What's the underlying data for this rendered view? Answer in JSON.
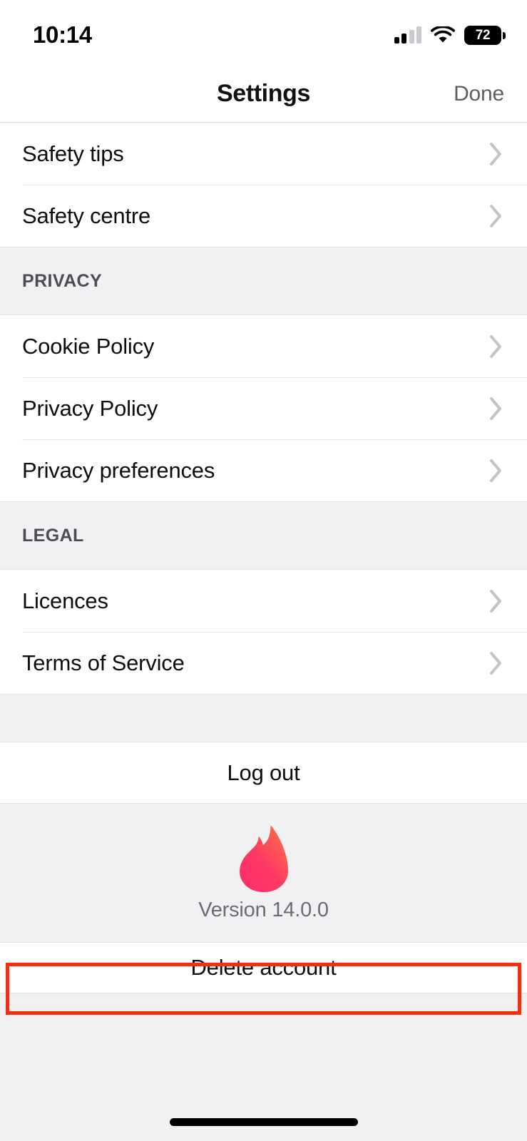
{
  "status_bar": {
    "time": "10:14",
    "signal_icon": "cellular-signal-icon",
    "wifi_icon": "wifi-icon",
    "battery_level": "72"
  },
  "header": {
    "title": "Settings",
    "done_label": "Done"
  },
  "sections": [
    {
      "header": null,
      "rows": [
        {
          "label": "Safety tips",
          "accessory": "chevron-right-icon"
        },
        {
          "label": "Safety centre",
          "accessory": "chevron-right-icon"
        }
      ]
    },
    {
      "header": "PRIVACY",
      "rows": [
        {
          "label": "Cookie Policy",
          "accessory": "chevron-right-icon"
        },
        {
          "label": "Privacy Policy",
          "accessory": "chevron-right-icon"
        },
        {
          "label": "Privacy preferences",
          "accessory": "chevron-right-icon"
        }
      ]
    },
    {
      "header": "LEGAL",
      "rows": [
        {
          "label": "Licences",
          "accessory": "chevron-right-icon"
        },
        {
          "label": "Terms of Service",
          "accessory": "chevron-right-icon"
        }
      ]
    }
  ],
  "logout": {
    "label": "Log out"
  },
  "app_info": {
    "logo_icon": "tinder-flame-logo",
    "version": "Version 14.0.0"
  },
  "delete_account": {
    "label": "Delete account",
    "highlighted": true,
    "highlight_color": "#f52e10"
  },
  "colors": {
    "background": "#ffffff",
    "group_background": "#f1f1f4",
    "separator": "#e6e6e9",
    "primary_text": "#0d0d10",
    "secondary_text": "#6b6b70",
    "section_header_text": "#4c4c52",
    "chevron": "#c2c2c7",
    "logo_gradient_start": "#ff6b4a",
    "logo_gradient_end": "#fd2c6e",
    "annotation": "#f52e10"
  },
  "home_indicator": "home-indicator"
}
